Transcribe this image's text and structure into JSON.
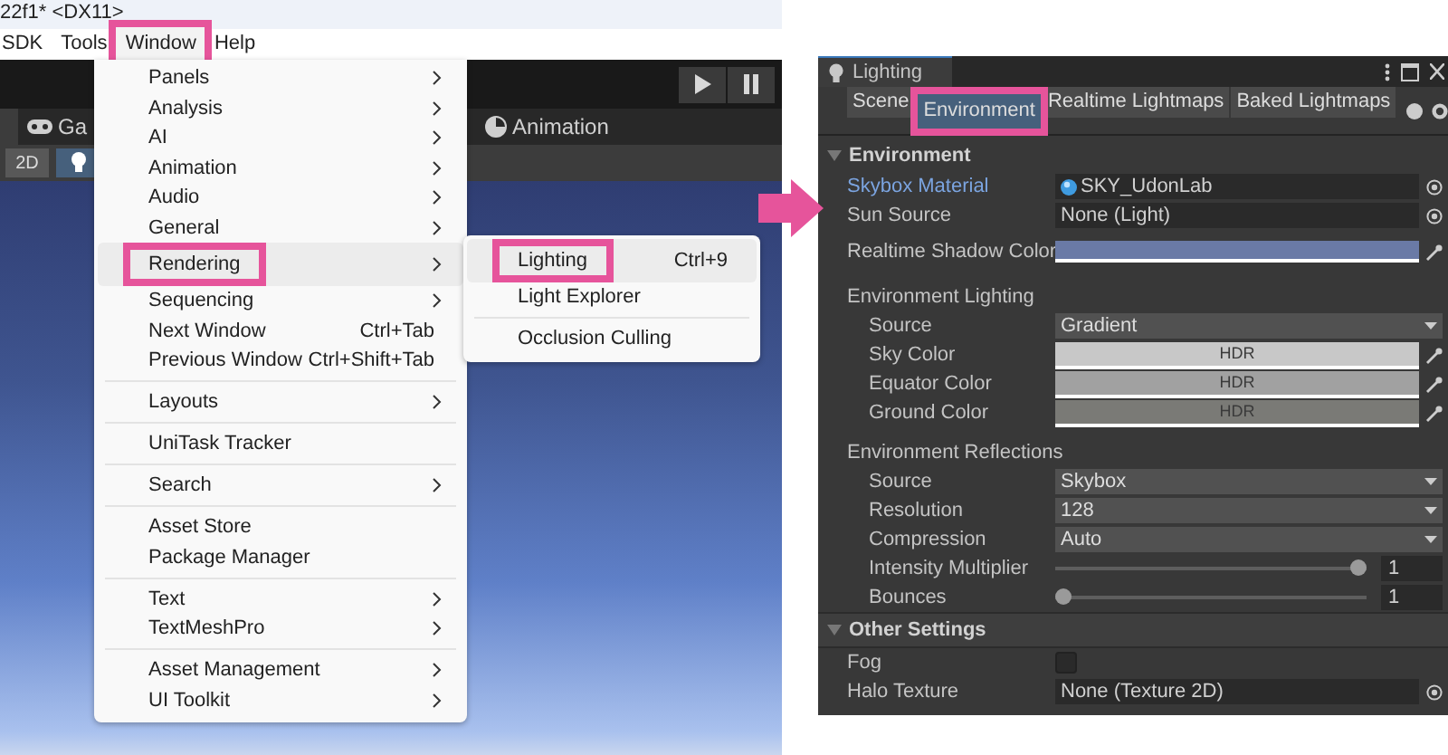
{
  "editor": {
    "title": "22f1* <DX11>",
    "menu_bar": [
      {
        "label": "SDK",
        "selected": false,
        "callout": false
      },
      {
        "label": "Tools",
        "selected": false,
        "callout": false
      },
      {
        "label": "Window",
        "selected": true,
        "callout": true
      },
      {
        "label": "Help",
        "selected": false,
        "callout": false
      }
    ],
    "view_tabs": [
      {
        "label": "Ga",
        "kind": "game"
      },
      {
        "label": "Animation",
        "kind": "animation"
      }
    ],
    "scene_buttons": [
      {
        "label": "2D",
        "kind": "text",
        "selected": false
      },
      {
        "kind": "light",
        "selected": true
      }
    ]
  },
  "window_menu": {
    "groups": [
      [
        {
          "label": "Panels",
          "has_submenu": true,
          "selected": false,
          "callout": false
        },
        {
          "label": "Analysis",
          "has_submenu": true,
          "selected": false,
          "callout": false
        },
        {
          "label": "AI",
          "has_submenu": true,
          "selected": false,
          "callout": false
        },
        {
          "label": "Animation",
          "has_submenu": true,
          "selected": false,
          "callout": false
        },
        {
          "label": "Audio",
          "has_submenu": true,
          "selected": false,
          "callout": false
        },
        {
          "label": "General",
          "has_submenu": true,
          "selected": false,
          "callout": false
        },
        {
          "label": "Rendering",
          "has_submenu": true,
          "selected": true,
          "callout": true
        },
        {
          "label": "Sequencing",
          "has_submenu": true,
          "selected": false,
          "callout": false
        },
        {
          "label": "Next Window",
          "shortcut": "Ctrl+Tab",
          "has_submenu": false,
          "selected": false,
          "callout": false
        },
        {
          "label": "Previous Window",
          "shortcut": "Ctrl+Shift+Tab",
          "has_submenu": false,
          "selected": false,
          "callout": false
        }
      ],
      [
        {
          "label": "Layouts",
          "has_submenu": true,
          "selected": false,
          "callout": false
        }
      ],
      [
        {
          "label": "UniTask Tracker",
          "has_submenu": false,
          "selected": false,
          "callout": false
        }
      ],
      [
        {
          "label": "Search",
          "has_submenu": true,
          "selected": false,
          "callout": false
        }
      ],
      [
        {
          "label": "Asset Store",
          "has_submenu": false,
          "selected": false,
          "callout": false
        },
        {
          "label": "Package Manager",
          "has_submenu": false,
          "selected": false,
          "callout": false
        }
      ],
      [
        {
          "label": "Text",
          "has_submenu": true,
          "selected": false,
          "callout": false
        },
        {
          "label": "TextMeshPro",
          "has_submenu": true,
          "selected": false,
          "callout": false
        }
      ],
      [
        {
          "label": "Asset Management",
          "has_submenu": true,
          "selected": false,
          "callout": false
        },
        {
          "label": "UI Toolkit",
          "has_submenu": true,
          "selected": false,
          "callout": false
        }
      ]
    ]
  },
  "rendering_submenu": {
    "groups": [
      [
        {
          "label": "Lighting",
          "shortcut": "Ctrl+9",
          "selected": true,
          "callout": true
        },
        {
          "label": "Light Explorer",
          "selected": false,
          "callout": false
        }
      ],
      [
        {
          "label": "Occlusion Culling",
          "selected": false,
          "callout": false
        }
      ]
    ]
  },
  "lighting_window": {
    "title": "Lighting",
    "tabs": [
      {
        "label": "Scene",
        "selected": false,
        "callout": false
      },
      {
        "label": "Environment",
        "selected": true,
        "callout": true
      },
      {
        "label": "Realtime Lightmaps",
        "selected": false,
        "callout": false
      },
      {
        "label": "Baked Lightmaps",
        "selected": false,
        "callout": false
      }
    ],
    "sections": [
      {
        "title": "Environment",
        "expanded": true,
        "rows": [
          {
            "kind": "object",
            "label": "Skybox Material",
            "value": "SKY_UdonLab",
            "asset_icon": true,
            "focused": true
          },
          {
            "kind": "object",
            "label": "Sun Source",
            "value": "None (Light)",
            "asset_icon": false,
            "focused": false
          },
          {
            "kind": "color",
            "label": "Realtime Shadow Color",
            "color": "#6a7aa6",
            "focused": false
          },
          {
            "kind": "group",
            "label": "Environment Lighting",
            "focused": false,
            "children": [
              {
                "kind": "dropdown",
                "label": "Source",
                "value": "Gradient"
              },
              {
                "kind": "color",
                "label": "Sky Color",
                "color": "#c8c8c8",
                "hdr": "HDR"
              },
              {
                "kind": "color",
                "label": "Equator Color",
                "color": "#a1a1a1",
                "hdr": "HDR"
              },
              {
                "kind": "color",
                "label": "Ground Color",
                "color": "#7a7a76",
                "hdr": "HDR"
              }
            ]
          },
          {
            "kind": "group",
            "label": "Environment Reflections",
            "focused": false,
            "children": [
              {
                "kind": "dropdown",
                "label": "Source",
                "value": "Skybox"
              },
              {
                "kind": "dropdown",
                "label": "Resolution",
                "value": "128"
              },
              {
                "kind": "dropdown",
                "label": "Compression",
                "value": "Auto"
              },
              {
                "kind": "slider",
                "label": "Intensity Multiplier",
                "level": 1,
                "value": "1"
              },
              {
                "kind": "slider",
                "label": "Bounces",
                "level": 0,
                "value": "1"
              }
            ]
          }
        ]
      },
      {
        "title": "Other Settings",
        "expanded": true,
        "rows": [
          {
            "kind": "checkbox",
            "label": "Fog",
            "checked": false,
            "focused": false
          },
          {
            "kind": "object",
            "label": "Halo Texture",
            "value": "None (Texture 2D)",
            "asset_icon": false,
            "focused": false
          }
        ]
      }
    ]
  }
}
